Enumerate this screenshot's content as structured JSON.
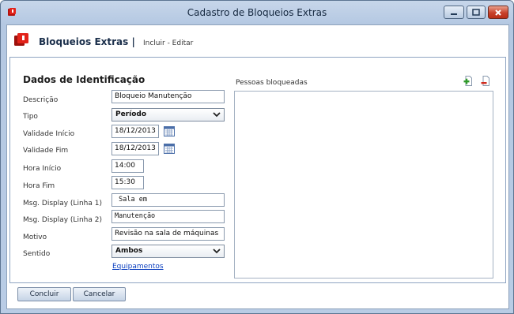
{
  "window": {
    "title": "Cadastro de Bloqueios Extras",
    "accent": "#c8412a"
  },
  "header": {
    "title": "Bloqueios Extras |",
    "subtitle": "Incluir - Editar"
  },
  "form": {
    "section_title": "Dados de Identificação",
    "fields": {
      "descricao": {
        "label": "Descrição",
        "value": "Bloqueio Manutenção"
      },
      "tipo": {
        "label": "Tipo",
        "value": "Período"
      },
      "validade_inicio": {
        "label": "Validade Início",
        "value": "18/12/2013"
      },
      "validade_fim": {
        "label": "Validade Fim",
        "value": "18/12/2013"
      },
      "hora_inicio": {
        "label": "Hora Início",
        "value": "14:00"
      },
      "hora_fim": {
        "label": "Hora Fim",
        "value": "15:30"
      },
      "msg_linha1": {
        "label": "Msg. Display (Linha 1)",
        "value": " Sala em"
      },
      "msg_linha2": {
        "label": "Msg. Display (Linha 2)",
        "value": "Manutenção"
      },
      "motivo": {
        "label": "Motivo",
        "value": "Revisão na sala de máquinas"
      },
      "sentido": {
        "label": "Sentido",
        "value": "Ambos"
      }
    },
    "equipamentos_link": "Equipamentos"
  },
  "people_panel": {
    "label": "Pessoas bloqueadas",
    "add_icon": "add-person-icon",
    "remove_icon": "remove-person-icon",
    "items": []
  },
  "footer": {
    "confirm_label": "Concluir",
    "cancel_label": "Cancelar"
  }
}
